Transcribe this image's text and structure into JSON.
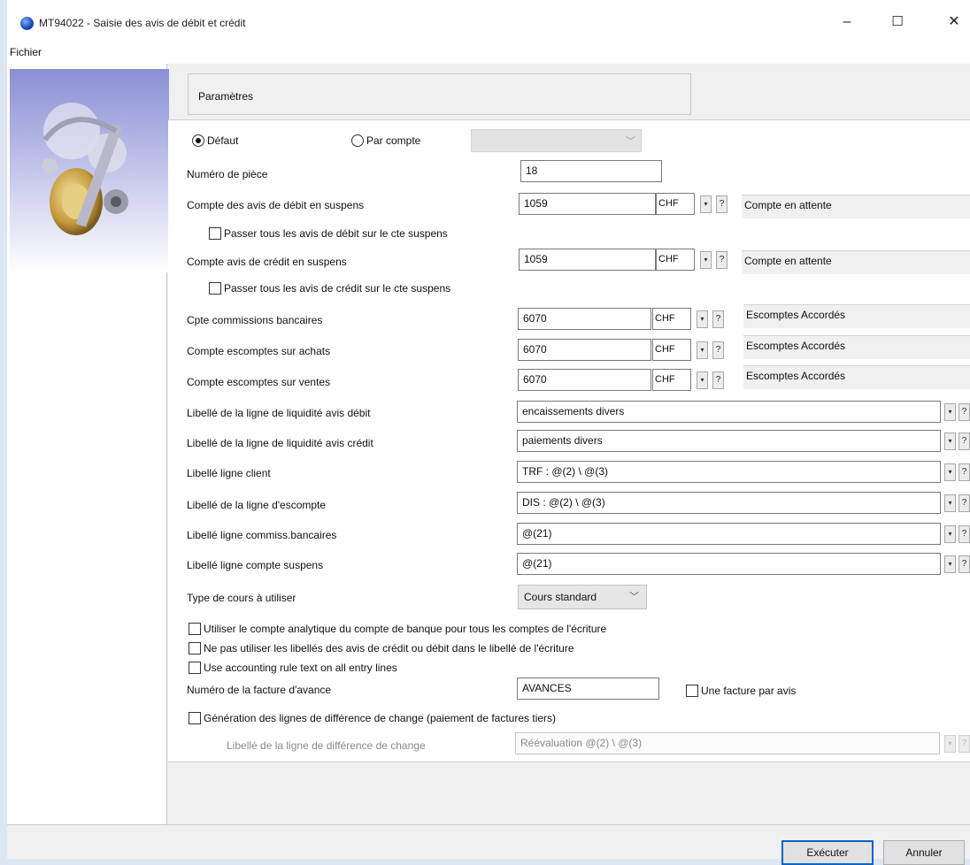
{
  "window": {
    "title": "MT94022 - Saisie des avis de débit et crédit",
    "minimize": "–",
    "maximize": "☐",
    "close": "✕"
  },
  "menu": {
    "fichier": "Fichier"
  },
  "params": {
    "title": "Paramètres"
  },
  "mode": {
    "defaut_label": "Défaut",
    "par_compte_label": "Par compte",
    "selected": "Défaut"
  },
  "fields": {
    "numero_piece": {
      "label": "Numéro de pièce",
      "value": "18"
    },
    "compte_debit": {
      "label": "Compte des avis de débit en suspens",
      "value": "1059",
      "currency": "CHF",
      "description": "Compte en attente"
    },
    "passer_debit": {
      "label": "Passer tous les avis de débit sur le cte suspens",
      "checked": false
    },
    "compte_credit": {
      "label": "Compte avis de crédit en suspens",
      "value": "1059",
      "currency": "CHF",
      "description": "Compte en attente"
    },
    "passer_credit": {
      "label": "Passer tous les avis de crédit sur le cte suspens",
      "checked": false
    },
    "cpte_commissions": {
      "label": "Cpte commissions bancaires",
      "value": "6070",
      "currency": "CHF",
      "description": "Escomptes  Accordés"
    },
    "compte_escomptes_achats": {
      "label": "Compte escomptes sur achats",
      "value": "6070",
      "currency": "CHF",
      "description": "Escomptes  Accordés"
    },
    "compte_escomptes_ventes": {
      "label": "Compte escomptes sur ventes",
      "value": "6070",
      "currency": "CHF",
      "description": "Escomptes  Accordés"
    },
    "libelle_liquidite_debit": {
      "label": "Libellé de la ligne de liquidité avis débit",
      "value": "encaissements divers"
    },
    "libelle_liquidite_credit": {
      "label": "Libellé de la ligne de liquidité avis crédit",
      "value": "paiements divers"
    },
    "libelle_client": {
      "label": "Libellé ligne client",
      "value": "TRF : @(2) \\ @(3)"
    },
    "libelle_escompte": {
      "label": "Libellé de la ligne d'escompte",
      "value": "DIS : @(2) \\ @(3)"
    },
    "libelle_commiss": {
      "label": "Libellé ligne commiss.bancaires",
      "value": "@(21)"
    },
    "libelle_suspens": {
      "label": "Libellé ligne compte suspens",
      "value": "@(21)"
    },
    "type_cours": {
      "label": "Type de cours à utiliser",
      "value": "Cours standard"
    },
    "utiliser_analytique": {
      "label": "Utiliser le compte analytique du compte de banque pour tous les comptes de  l'écriture",
      "checked": false
    },
    "ne_pas_utiliser": {
      "label": "Ne pas utiliser les libellés des avis de crédit ou débit dans le libellé de l'écriture",
      "checked": false
    },
    "use_accounting": {
      "label": "Use accounting rule text on all entry lines",
      "checked": false
    },
    "numero_facture_avance": {
      "label": "Numéro de la facture d'avance",
      "value": "AVANCES"
    },
    "une_facture": {
      "label": "Une facture par avis",
      "checked": false
    },
    "generation_diff": {
      "label": "Génération des lignes de différence de change (paiement de factures tiers)",
      "checked": false
    },
    "libelle_diff_change": {
      "label": "Libellé de la ligne de différence de change",
      "value": "Réévaluation @(2) \\ @(3)"
    }
  },
  "buttons": {
    "executer": "Exécuter",
    "annuler": "Annuler"
  },
  "glyphs": {
    "spin": "▾",
    "help": "?",
    "chevron": "﹀"
  }
}
